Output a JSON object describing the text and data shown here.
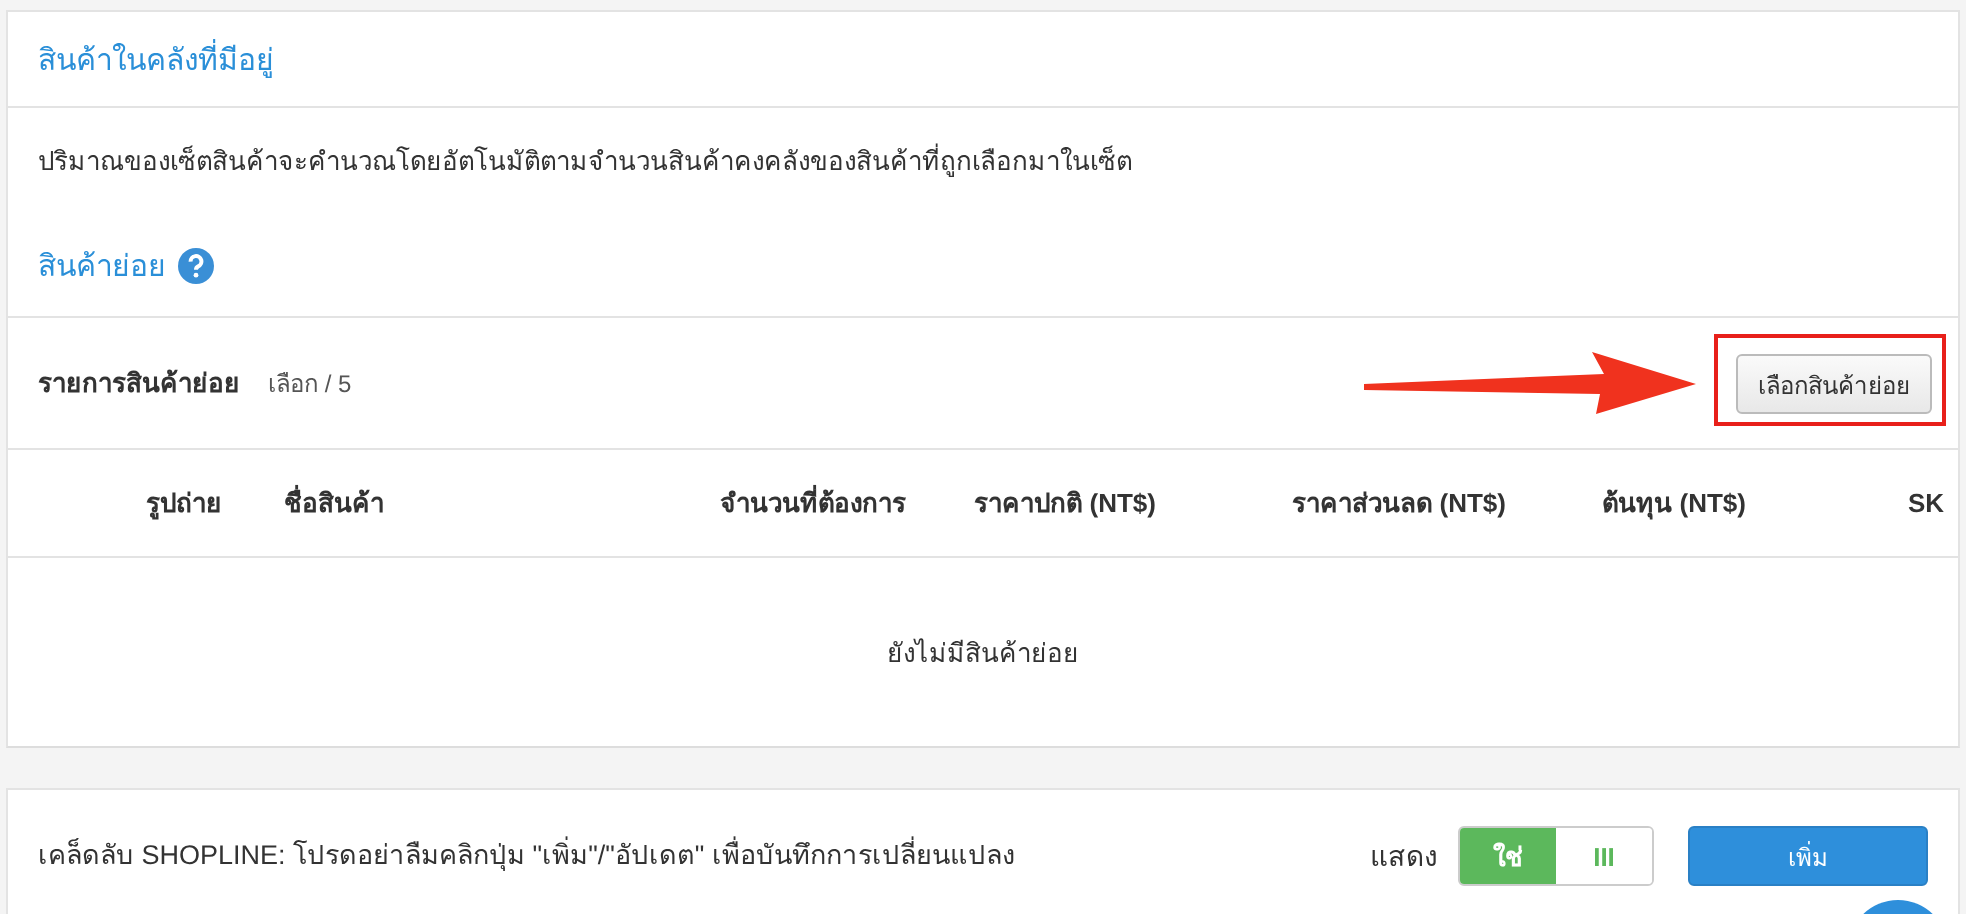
{
  "stock_section": {
    "title": "สินค้าในคลังที่มีอยู่",
    "description": "ปริมาณของเซ็ตสินค้าจะคำนวณโดยอัตโนมัติตามจำนวนสินค้าคงคลังของสินค้าที่ถูกเลือกมาในเซ็ต",
    "subtitle": "สินค้าย่อย"
  },
  "item_list": {
    "label": "รายการสินค้าย่อย",
    "count": "เลือก / 5",
    "select_button": "เลือกสินค้าย่อย",
    "highlighted": true
  },
  "table": {
    "columns": [
      "รูปถ่าย",
      "ชื่อสินค้า",
      "จำนวนที่ต้องการ",
      "ราคาปกติ (NT$)",
      "ราคาส่วนลด (NT$)",
      "ต้นทุน (NT$)",
      "SK"
    ],
    "empty_message": "ยังไม่มีสินค้าย่อย"
  },
  "footer": {
    "tip": "เคล็ดลับ SHOPLINE: โปรดอย่าลืมคลิกปุ่ม \"เพิ่ม\"/\"อัปเดต\" เพื่อบันทึกการเปลี่ยนแปลง",
    "show_label": "แสดง",
    "toggle": [
      {
        "label": "ใช่",
        "selected": true
      },
      {
        "label": "III",
        "selected": false
      }
    ],
    "add_button": "เพิ่ม"
  }
}
